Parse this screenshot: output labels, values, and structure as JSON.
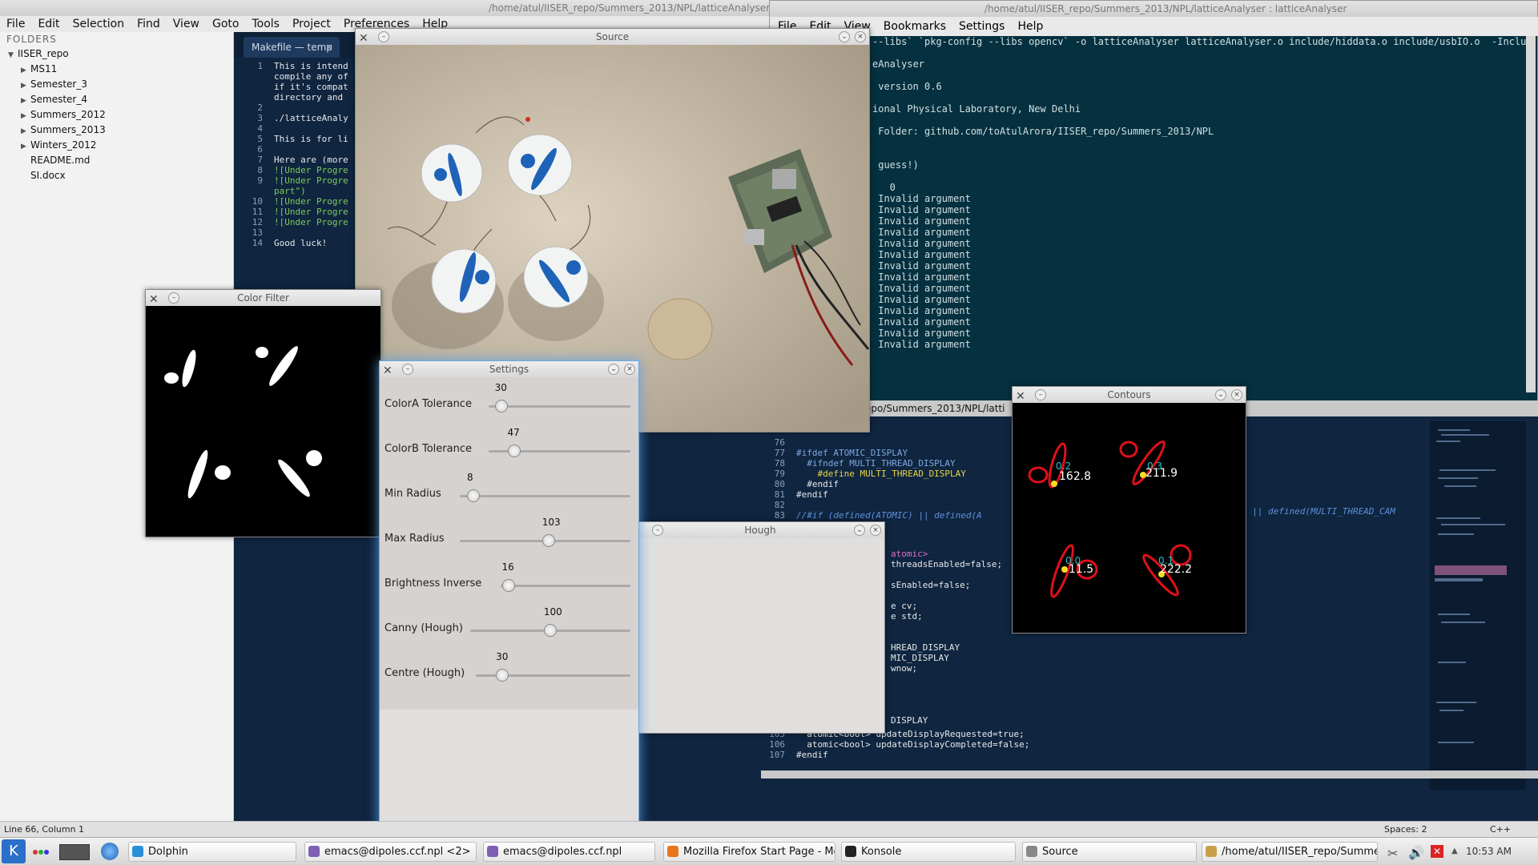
{
  "editor": {
    "title": "/home/atul/IISER_repo/Summers_2013/NPL/latticeAnalyser/latt",
    "menu": [
      "File",
      "Edit",
      "Selection",
      "Find",
      "View",
      "Goto",
      "Tools",
      "Project",
      "Preferences",
      "Help"
    ],
    "sidebar_header": "FOLDERS",
    "tree": [
      {
        "label": "IISER_repo",
        "arrow": "▼",
        "indent": 0
      },
      {
        "label": "MS11",
        "arrow": "▶",
        "indent": 1
      },
      {
        "label": "Semester_3",
        "arrow": "▶",
        "indent": 1
      },
      {
        "label": "Semester_4",
        "arrow": "▶",
        "indent": 1
      },
      {
        "label": "Summers_2012",
        "arrow": "▶",
        "indent": 1
      },
      {
        "label": "Summers_2013",
        "arrow": "▶",
        "indent": 1
      },
      {
        "label": "Winters_2012",
        "arrow": "▶",
        "indent": 1
      },
      {
        "label": "README.md",
        "arrow": "",
        "indent": 1
      },
      {
        "label": "SI.docx",
        "arrow": "",
        "indent": 1
      }
    ],
    "tab_label": "Makefile — temp",
    "code_lines": [
      {
        "n": "1",
        "t": "This is intend",
        "c": ""
      },
      {
        "n": "",
        "t": "compile any of",
        "c": ""
      },
      {
        "n": "",
        "t": "if it's compat",
        "c": ""
      },
      {
        "n": "",
        "t": "directory and",
        "c": ""
      },
      {
        "n": "2",
        "t": "",
        "c": ""
      },
      {
        "n": "3",
        "t": "./latticeAnaly",
        "c": ""
      },
      {
        "n": "4",
        "t": "",
        "c": ""
      },
      {
        "n": "5",
        "t": "This is for li",
        "c": ""
      },
      {
        "n": "6",
        "t": "",
        "c": ""
      },
      {
        "n": "7",
        "t": "Here are (more",
        "c": ""
      },
      {
        "n": "8",
        "t": "![Under Progre",
        "c": "gr"
      },
      {
        "n": "9",
        "t": "![Under Progre",
        "c": "gr"
      },
      {
        "n": "",
        "t": "part\")",
        "c": "gr"
      },
      {
        "n": "10",
        "t": "![Under Progre",
        "c": "gr"
      },
      {
        "n": "11",
        "t": "![Under Progre",
        "c": "gr"
      },
      {
        "n": "12",
        "t": "![Under Progre",
        "c": "gr"
      },
      {
        "n": "13",
        "t": "",
        "c": ""
      },
      {
        "n": "14",
        "t": "Good luck!",
        "c": ""
      }
    ],
    "status_left": "Line 66, Column 1",
    "status_spaces": "Spaces: 2",
    "status_lang": "C++"
  },
  "konsole": {
    "title": "/home/atul/IISER_repo/Summers_2013/NPL/latticeAnalyser : latticeAnalyser",
    "menu": [
      "File",
      "Edit",
      "View",
      "Bookmarks",
      "Settings",
      "Help"
    ],
    "lines": [
      "--libs` `pkg-config --libs opencv` -o latticeAnalyser latticeAnalyser.o include/hiddata.o include/usbIO.o  -Inclu",
      "",
      "eAnalyser",
      "",
      " version 0.6",
      "",
      "ional Physical Laboratory, New Delhi",
      "",
      " Folder: github.com/toAtulArora/IISER_repo/Summers_2013/NPL",
      "",
      "",
      " guess!)",
      "",
      "   0",
      " Invalid argument",
      " Invalid argument",
      " Invalid argument",
      " Invalid argument",
      " Invalid argument",
      " Invalid argument",
      " Invalid argument",
      " Invalid argument",
      " Invalid argument",
      " Invalid argument",
      " Invalid argument",
      " Invalid argument",
      " Invalid argument",
      " Invalid argument"
    ]
  },
  "emacs2": {
    "modebar_text": "epo/Summers_2013/NPL/latti",
    "lines": [
      {
        "n": "76",
        "t": "",
        "c": ""
      },
      {
        "n": "77",
        "t": "#ifdef ATOMIC_DISPLAY",
        "c": "kw"
      },
      {
        "n": "78",
        "t": "  #ifndef MULTI_THREAD_DISPLAY",
        "c": "kw"
      },
      {
        "n": "79",
        "t": "    #define MULTI_THREAD_DISPLAY",
        "c": "yel"
      },
      {
        "n": "80",
        "t": "  #endif",
        "c": ""
      },
      {
        "n": "81",
        "t": "#endif",
        "c": ""
      },
      {
        "n": "82",
        "t": "",
        "c": ""
      },
      {
        "n": "83",
        "t": "//#if (defined(ATOMIC) || defined(A",
        "c": "cm"
      },
      {
        "n": "",
        "t": "",
        "c": ""
      },
      {
        "n": "",
        "t": "",
        "c": ""
      },
      {
        "n": "",
        "t": "",
        "c": ""
      },
      {
        "n": "",
        "t": "",
        "c": ""
      },
      {
        "n": "",
        "t": "",
        "c": ""
      },
      {
        "n": "",
        "t": "",
        "c": ""
      },
      {
        "n": "",
        "t": "",
        "c": ""
      },
      {
        "n": "",
        "t": "",
        "c": ""
      },
      {
        "n": "",
        "t": "",
        "c": ""
      },
      {
        "n": "",
        "t": "",
        "c": ""
      },
      {
        "n": "",
        "t": "",
        "c": ""
      },
      {
        "n": "",
        "t": "",
        "c": ""
      },
      {
        "n": "",
        "t": "",
        "c": ""
      },
      {
        "n": "",
        "t": "",
        "c": ""
      },
      {
        "n": "",
        "t": "",
        "c": ""
      },
      {
        "n": "",
        "t": "",
        "c": ""
      },
      {
        "n": "",
        "t": "",
        "c": ""
      },
      {
        "n": "",
        "t": "",
        "c": ""
      },
      {
        "n": "",
        "t": "",
        "c": ""
      },
      {
        "n": "",
        "t": "",
        "c": ""
      },
      {
        "n": "105",
        "t": "  atomic<bool> updateDisplayRequested=true;",
        "c": ""
      },
      {
        "n": "106",
        "t": "  atomic<bool> updateDisplayCompleted=false;",
        "c": ""
      },
      {
        "n": "107",
        "t": "#endif",
        "c": ""
      }
    ],
    "right_tail": "LAY) || defined(MULTI_THREAD_CAM",
    "fragments": [
      {
        "t": "atomic>",
        "row": 11
      },
      {
        "t": "threadsEnabled=false;",
        "row": 12
      },
      {
        "t": "sEnabled=false;",
        "row": 14
      },
      {
        "t": "e cv;",
        "row": 16
      },
      {
        "t": "e std;",
        "row": 17
      },
      {
        "t": "HREAD_DISPLAY",
        "row": 20
      },
      {
        "t": "MIC_DISPLAY",
        "row": 21
      },
      {
        "t": "wnow;",
        "row": 22
      },
      {
        "t": "DISPLAY",
        "row": 27
      }
    ],
    "frag_atomic": "atomic>"
  },
  "source": {
    "title": "Source"
  },
  "color_filter": {
    "title": "Color Filter"
  },
  "hough": {
    "title": "Hough"
  },
  "contours": {
    "title": "Contours",
    "labels": [
      {
        "a": "0.2",
        "b": "162.8"
      },
      {
        "a": "0.3",
        "b": "211.9"
      },
      {
        "a": "0.0",
        "b": "11.5"
      },
      {
        "a": "0.1",
        "b": "222.2"
      }
    ]
  },
  "settings": {
    "title": "Settings",
    "sliders": [
      {
        "label": "ColorA Tolerance",
        "value": "30",
        "fraction": 0.09
      },
      {
        "label": "ColorB Tolerance",
        "value": "47",
        "fraction": 0.18
      },
      {
        "label": "Min Radius",
        "value": "8",
        "fraction": 0.08
      },
      {
        "label": "Max Radius",
        "value": "103",
        "fraction": 0.52
      },
      {
        "label": "Brightness Inverse",
        "value": "16",
        "fraction": 0.06
      },
      {
        "label": "Canny (Hough)",
        "value": "100",
        "fraction": 0.5
      },
      {
        "label": "Centre (Hough)",
        "value": "30",
        "fraction": 0.17
      }
    ]
  },
  "taskbar": {
    "tasks": [
      "Dolphin",
      "emacs@dipoles.ccf.npl <2>",
      "emacs@dipoles.ccf.npl",
      "Mozilla Firefox Start Page - Mo",
      "Konsole",
      "Source",
      "/home/atul/IISER_repo/Summe"
    ],
    "clock": "10:53 AM"
  },
  "colors": {
    "accent": "#2a6fc9",
    "disc_blue": "#1e63b8",
    "contour_red": "#e0101a"
  }
}
